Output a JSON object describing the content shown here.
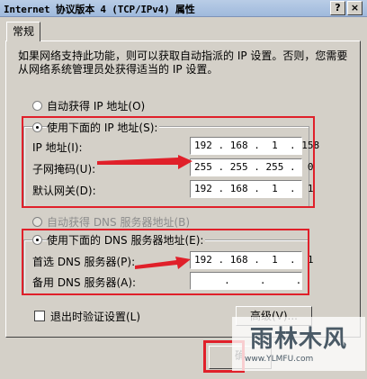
{
  "window": {
    "title": "Internet 协议版本 4 (TCP/IPv4) 属性",
    "help_button": "?",
    "close_button": "×"
  },
  "tabs": [
    {
      "label": "常规"
    }
  ],
  "description": "如果网络支持此功能，则可以获取自动指派的 IP 设置。否则，您需要从网络系统管理员处获得适当的 IP 设置。",
  "ip_section": {
    "auto_label": "自动获得 IP 地址(O)",
    "manual_label": "使用下面的 IP 地址(S):",
    "fields": [
      {
        "label": "IP 地址(I):",
        "value": "192 . 168 .  1  . 158"
      },
      {
        "label": "子网掩码(U):",
        "value": "255 . 255 . 255 .  0"
      },
      {
        "label": "默认网关(D):",
        "value": "192 . 168 .  1  .  1"
      }
    ]
  },
  "dns_section": {
    "auto_label": "自动获得 DNS 服务器地址(B)",
    "manual_label": "使用下面的 DNS 服务器地址(E):",
    "fields": [
      {
        "label": "首选 DNS 服务器(P):",
        "value": "192 . 168 .  1  .  1"
      },
      {
        "label": "备用 DNS 服务器(A):",
        "value": "     .     .     .    "
      }
    ]
  },
  "validate_on_exit_label": "退出时验证设置(L)",
  "advanced_button": "高级(V)...",
  "ok_button": "确",
  "watermark": {
    "logo_text": "雨林木风",
    "url": "www.YLMFU.com"
  },
  "colors": {
    "annotation_red": "#e0202a",
    "titlebar": "#b9cde6",
    "dialog_bg": "#d4d0c8"
  }
}
